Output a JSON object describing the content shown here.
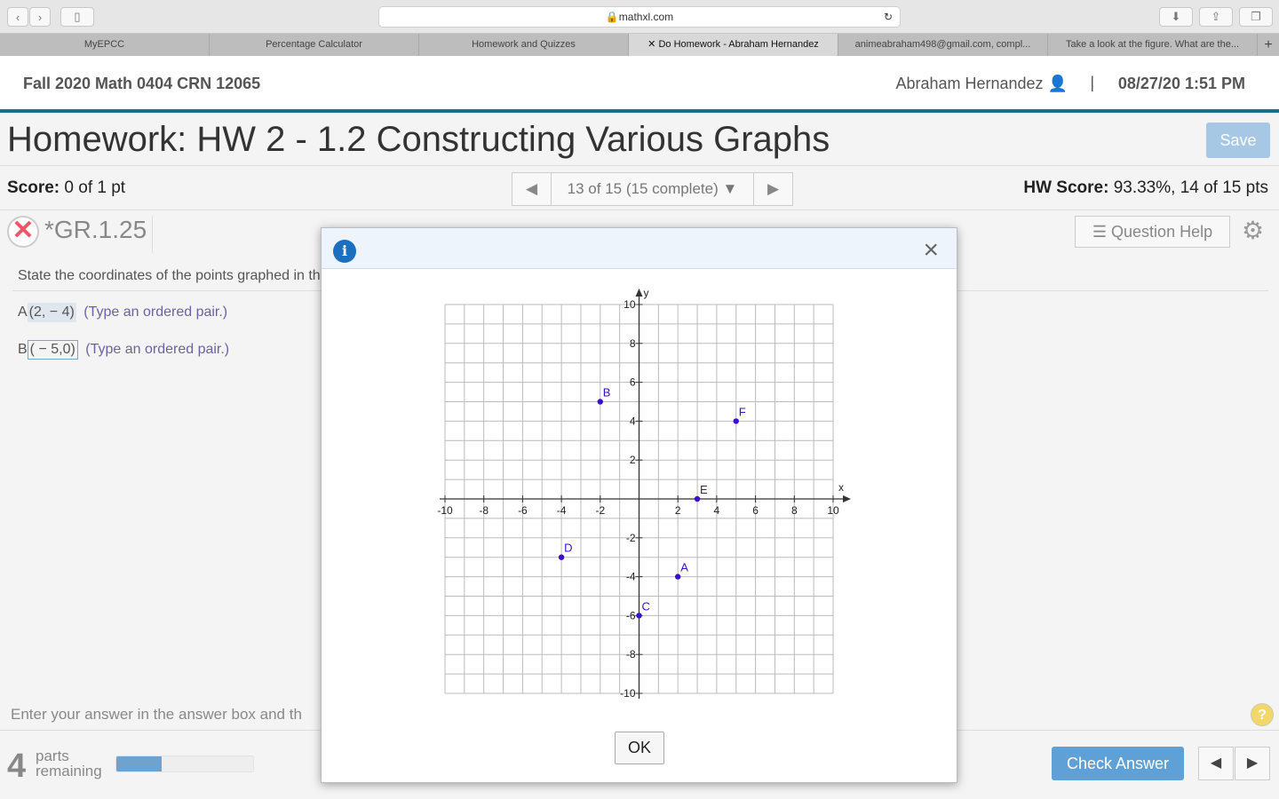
{
  "browser": {
    "url": "mathxl.com",
    "tabs": [
      "MyEPCC",
      "Percentage Calculator",
      "Homework and Quizzes",
      "Do Homework - Abraham Hernandez",
      "animeabraham498@gmail.com, compl...",
      "Take a look at the figure. What are the..."
    ],
    "active_tab": 3
  },
  "header": {
    "course": "Fall 2020 Math 0404 CRN 12065",
    "user": "Abraham Hernandez",
    "separator": "|",
    "datetime": "08/27/20 1:51 PM"
  },
  "title": "Homework: HW 2 - 1.2 Constructing Various Graphs",
  "save_label": "Save",
  "score": {
    "label": "Score:",
    "value": "0 of 1 pt"
  },
  "nav": {
    "position": "13 of 15 (15 complete)"
  },
  "hw_score": {
    "label": "HW Score:",
    "value": "93.33%, 14 of 15 pts"
  },
  "question": {
    "id": "*GR.1.25",
    "help_label": "Question Help",
    "prompt": "State the coordinates of the points graphed in th",
    "answers": [
      {
        "label": "A",
        "value": "(2, − 4)",
        "hint": "(Type an ordered pair.)"
      },
      {
        "label": "B",
        "value": "( − 5,0)",
        "hint": "(Type an ordered pair.)"
      }
    ]
  },
  "footer": {
    "instructions": "Enter your answer in the answer box and th",
    "parts_count": "4",
    "parts_label1": "parts",
    "parts_label2": "remaining",
    "progress_percent": 33,
    "check_label": "Check Answer",
    "help": "?"
  },
  "modal": {
    "ok_label": "OK",
    "info": "i",
    "close": "×"
  },
  "chart_data": {
    "type": "scatter",
    "xlabel": "x",
    "ylabel": "y",
    "xlim": [
      -10,
      10
    ],
    "ylim": [
      -10,
      10
    ],
    "grid": true,
    "xticks": [
      -10,
      -8,
      -6,
      -4,
      -2,
      2,
      4,
      6,
      8,
      10
    ],
    "yticks": [
      10,
      8,
      6,
      4,
      2,
      -2,
      -4,
      -6,
      -8,
      -10
    ],
    "points": [
      {
        "label": "A",
        "x": 2,
        "y": -4
      },
      {
        "label": "B",
        "x": -2,
        "y": 5
      },
      {
        "label": "C",
        "x": 0,
        "y": -6
      },
      {
        "label": "D",
        "x": -4,
        "y": -3
      },
      {
        "label": "E",
        "x": 3,
        "y": 0
      },
      {
        "label": "F",
        "x": 5,
        "y": 4
      }
    ],
    "point_color": "#3a10c8"
  }
}
